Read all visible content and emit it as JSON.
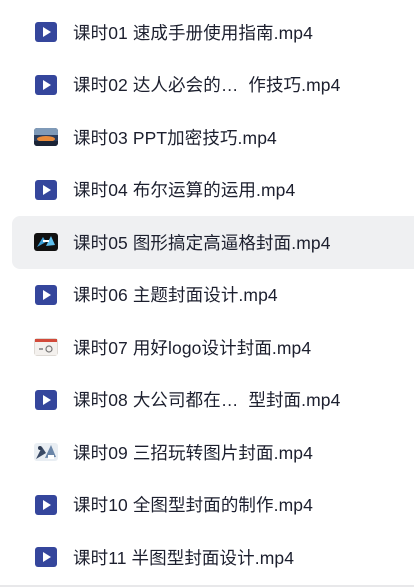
{
  "files": [
    {
      "name": "课时01 速成手册使用指南.mp4",
      "icon": "video-file-icon"
    },
    {
      "name": "课时02 达人必会的…  作技巧.mp4",
      "icon": "video-file-icon"
    },
    {
      "name": "课时03 PPT加密技巧.mp4",
      "icon": "video-thumbnail-icon"
    },
    {
      "name": "课时04 布尔运算的运用.mp4",
      "icon": "video-file-icon"
    },
    {
      "name": "课时05 图形搞定高逼格封面.mp4",
      "icon": "video-thumbnail-icon",
      "selected": true
    },
    {
      "name": "课时06 主题封面设计.mp4",
      "icon": "video-file-icon"
    },
    {
      "name": "课时07 用好logo设计封面.mp4",
      "icon": "video-thumbnail-icon"
    },
    {
      "name": "课时08 大公司都在…  型封面.mp4",
      "icon": "video-file-icon"
    },
    {
      "name": "课时09 三招玩转图片封面.mp4",
      "icon": "video-thumbnail-icon"
    },
    {
      "name": "课时10 全图型封面的制作.mp4",
      "icon": "video-file-icon"
    },
    {
      "name": "课时11 半图型封面设计.mp4",
      "icon": "video-file-icon"
    }
  ],
  "colors": {
    "icon_blue": "#35469c",
    "selected_row": "#eff0f2",
    "text": "#1c1f2e"
  }
}
